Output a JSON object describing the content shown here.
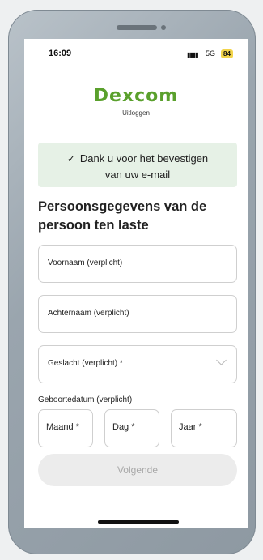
{
  "status_bar": {
    "time": "16:09",
    "network": "5G",
    "battery": "84"
  },
  "header": {
    "logo_text": "Dexcom",
    "logout_label": "Uitloggen",
    "brand_color": "#5aa02c"
  },
  "alert": {
    "line1": "Dank u voor het bevestigen",
    "line2": "van uw e-mail"
  },
  "form": {
    "title": "Persoonsgegevens van de persoon ten laste",
    "first_name_placeholder": "Voornaam (verplicht)",
    "last_name_placeholder": "Achternaam (verplicht)",
    "gender_select": "Geslacht (verplicht) *",
    "dob_label": "Geboortedatum (verplicht)",
    "month_placeholder": "Maand *",
    "day_placeholder": "Dag *",
    "year_placeholder": "Jaar *",
    "next_label": "Volgende"
  },
  "icons": {
    "check": "check-icon",
    "chevron": "chevron-down-icon"
  }
}
